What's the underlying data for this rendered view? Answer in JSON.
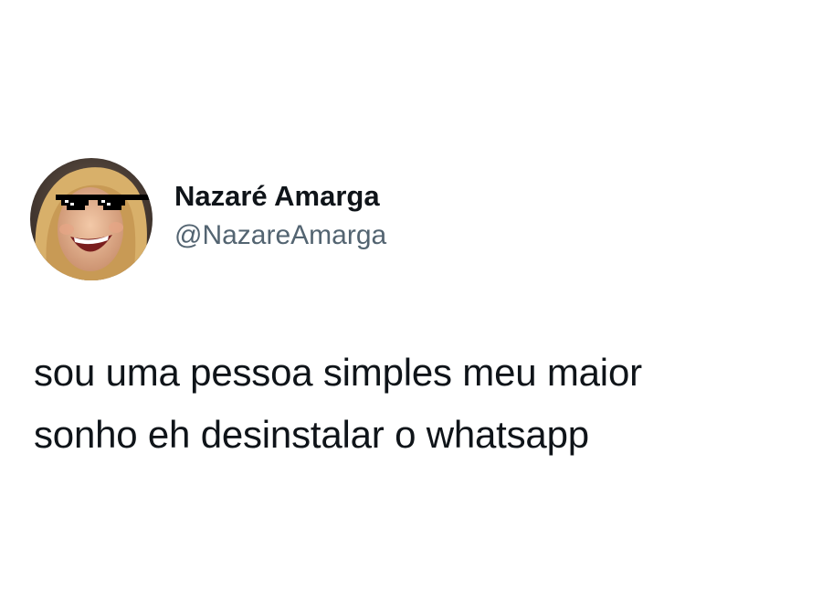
{
  "tweet": {
    "author": {
      "display_name": "Nazaré Amarga",
      "handle": "@NazareAmarga",
      "avatar_icon": "avatar-woman-laughing-with-pixel-sunglasses"
    },
    "text_lines": [
      "sou uma pessoa simples meu maior",
      "sonho eh desinstalar o whatsapp"
    ]
  },
  "colors": {
    "background": "#ffffff",
    "name": "#0f1419",
    "handle": "#536471",
    "body_text": "#0f1419"
  }
}
